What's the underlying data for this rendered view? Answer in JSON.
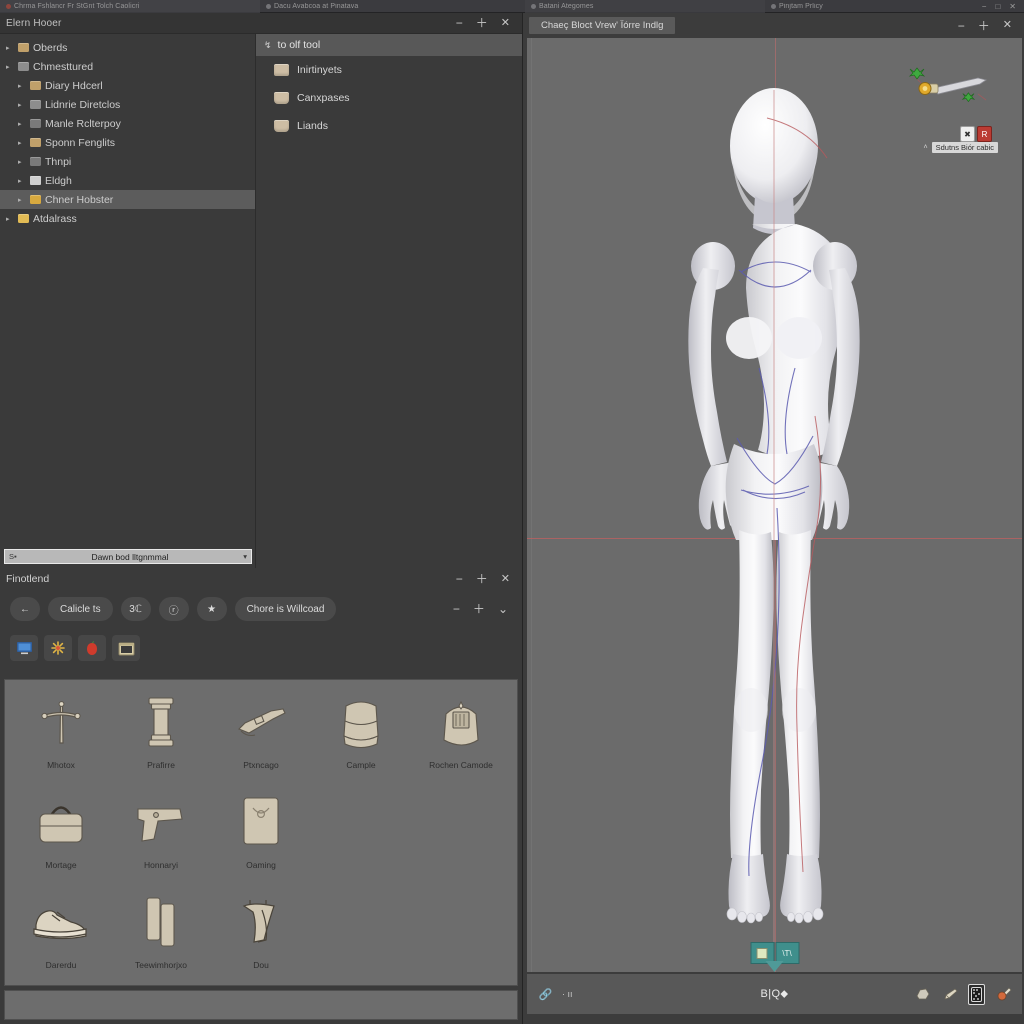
{
  "tabstrip": {
    "tabs": [
      {
        "label": "Chrma Fshlancr Fr StGnt Tolch Caolicri",
        "icon": "record-dot-icon"
      },
      {
        "label": "Dacu Avabcoa at Pinatava",
        "icon": "circle-icon"
      },
      {
        "label": "Batani Ategomes",
        "icon": "circle-icon"
      },
      {
        "label": "Pinjtam Prlicy",
        "icon": "circle-icon"
      }
    ],
    "window_controls": [
      "−",
      "□",
      "✕"
    ]
  },
  "file_browser": {
    "title": "Elern Hooer",
    "window_controls": {
      "minimize": "−",
      "maximize": "＋",
      "close": "✕"
    },
    "tree": [
      {
        "label": "Oberds",
        "depth": 1,
        "icon": "folder-icon",
        "icon_color": "tan",
        "selected": false
      },
      {
        "label": "Chmesttured",
        "depth": 1,
        "icon": "folder-gray-icon",
        "icon_color": "gray",
        "selected": false
      },
      {
        "label": "Diary Hdcerl",
        "depth": 2,
        "icon": "folder-icon",
        "icon_color": "tan",
        "selected": false
      },
      {
        "label": "Lidnrie Diretclos",
        "depth": 2,
        "icon": "folder-icon",
        "icon_color": "gray",
        "selected": false
      },
      {
        "label": "Manle Rclterpoy",
        "depth": 2,
        "icon": "folder-icon",
        "icon_color": "dgry",
        "selected": false
      },
      {
        "label": "Sponn Fenglits",
        "depth": 2,
        "icon": "folder-icon",
        "icon_color": "tan",
        "selected": false
      },
      {
        "label": "Thnpi",
        "depth": 2,
        "icon": "folder-icon",
        "icon_color": "dgry",
        "selected": false
      },
      {
        "label": "Eldgh",
        "depth": 2,
        "icon": "document-icon",
        "icon_color": "doc",
        "selected": false
      },
      {
        "label": "Chner Hobster",
        "depth": 2,
        "icon": "folder-open-icon",
        "icon_color": "yel",
        "selected": true
      },
      {
        "label": "Atdalrass",
        "depth": 1,
        "icon": "folder-icon",
        "icon_color": "lyel",
        "selected": false
      }
    ],
    "list": {
      "column_header": "to olf tool",
      "sort_icon": "sort-arrow-icon",
      "items": [
        {
          "label": "Inirtinyets",
          "icon": "folder-thumb-icon"
        },
        {
          "label": "Canxpases",
          "icon": "folder-thumb-icon"
        },
        {
          "label": "Liands",
          "icon": "folder-thumb-icon"
        }
      ]
    },
    "filename_bar": {
      "prefix": "S▪",
      "value": "Dawn bod  lltgnmmal",
      "suffix": "▾"
    }
  },
  "asset_browser": {
    "title": "Finotlend",
    "window_controls": {
      "minimize": "−",
      "maximize": "＋",
      "close": "✕"
    },
    "toolbar": {
      "back_icon": "back-arrow-icon",
      "buttons": [
        {
          "label": "Calicle ts",
          "name": "collections-button"
        },
        {
          "label": "3ℂ",
          "name": "3d-toggle-button"
        },
        {
          "label": "ⓡ",
          "name": "filter-button"
        },
        {
          "label": "★",
          "name": "favorites-button"
        },
        {
          "label": "Chore is Willcoad",
          "name": "choice-wildcard-button"
        }
      ],
      "right_controls": {
        "minimize": "−",
        "maximize": "＋",
        "expand": "⌄"
      }
    },
    "app_icons": [
      {
        "name": "monitor-icon",
        "glyph": "🖥"
      },
      {
        "name": "sparkle-icon",
        "glyph": "✹"
      },
      {
        "name": "apple-icon",
        "glyph": "🍎"
      },
      {
        "name": "window-icon",
        "glyph": "🗔"
      }
    ],
    "grid": [
      {
        "label": "Mhotox",
        "icon": "pickaxe-icon"
      },
      {
        "label": "Prafirre",
        "icon": "column-icon"
      },
      {
        "label": "Ptxncago",
        "icon": "tool-icon"
      },
      {
        "label": "Cample",
        "icon": "backpack-icon"
      },
      {
        "label": "Rochen Camode",
        "icon": "helmet-icon"
      },
      {
        "label": "Mortage",
        "icon": "handbag-icon"
      },
      {
        "label": "Honnaryi",
        "icon": "pistol-icon"
      },
      {
        "label": "Oaming",
        "icon": "pouch-icon"
      },
      {
        "label": "Darerdu",
        "icon": "sneaker-icon"
      },
      {
        "label": "Teewimhorjxo",
        "icon": "bottles-icon"
      },
      {
        "label": "Dou",
        "icon": "boots-icon"
      }
    ]
  },
  "viewport": {
    "tab_label": "Chaeç Bloct Vrew' Ïórre Indlg",
    "window_controls": {
      "minimize": "−",
      "maximize": "＋",
      "close": "✕"
    },
    "gizmo": {
      "object_name": "dagger-gizmo",
      "tooltip": "Sdutns Biór cabic",
      "caret": "˄",
      "badges": [
        {
          "label": "✖",
          "name": "gizmo-badge-cut"
        },
        {
          "label": "R",
          "name": "gizmo-badge-record",
          "accent": true
        }
      ]
    },
    "drop_widget": {
      "left_label": "▣",
      "right_label": "\\T\\"
    },
    "status_bar": {
      "left_icon": "link-icon",
      "left_text": "· ıı",
      "center_text": "B|Q⬥",
      "right_icons": [
        {
          "name": "rock-icon",
          "glyph": "◖"
        },
        {
          "name": "brush-icon",
          "glyph": "✒"
        },
        {
          "name": "phone-icon",
          "glyph": "▦"
        },
        {
          "name": "color-picker-icon",
          "glyph": "☂"
        }
      ]
    },
    "colors": {
      "canvas": "#6b6b6b",
      "axis_red": "#c65f5f",
      "seam_blue": "#5b5bb0",
      "teal_accent": "#3f8f8c"
    }
  }
}
